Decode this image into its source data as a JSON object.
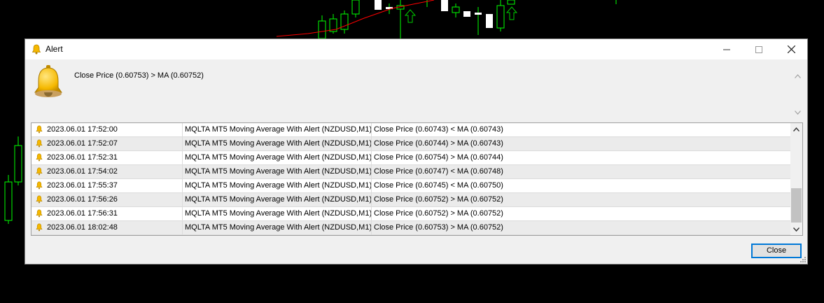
{
  "window": {
    "title": "Alert",
    "minimize_icon": "minimize-icon",
    "maximize_icon": "maximize-icon",
    "close_icon": "close-x-icon"
  },
  "icons": {
    "title": "bell-icon",
    "large": "bell-icon",
    "row": "bell-icon"
  },
  "message": "Close Price (0.60753) > MA (0.60752)",
  "alerts": [
    {
      "time": "2023.06.01 17:52:00",
      "source": "MQLTA MT5 Moving Average With Alert (NZDUSD,M1)",
      "text": "Close Price (0.60743) < MA (0.60743)"
    },
    {
      "time": "2023.06.01 17:52:07",
      "source": "MQLTA MT5 Moving Average With Alert (NZDUSD,M1)",
      "text": "Close Price (0.60744) > MA (0.60743)"
    },
    {
      "time": "2023.06.01 17:52:31",
      "source": "MQLTA MT5 Moving Average With Alert (NZDUSD,M1)",
      "text": "Close Price (0.60754) > MA (0.60744)"
    },
    {
      "time": "2023.06.01 17:54:02",
      "source": "MQLTA MT5 Moving Average With Alert (NZDUSD,M1)",
      "text": "Close Price (0.60747) < MA (0.60748)"
    },
    {
      "time": "2023.06.01 17:55:37",
      "source": "MQLTA MT5 Moving Average With Alert (NZDUSD,M1)",
      "text": "Close Price (0.60745) < MA (0.60750)"
    },
    {
      "time": "2023.06.01 17:56:26",
      "source": "MQLTA MT5 Moving Average With Alert (NZDUSD,M1)",
      "text": "Close Price (0.60752) > MA (0.60752)"
    },
    {
      "time": "2023.06.01 17:56:31",
      "source": "MQLTA MT5 Moving Average With Alert (NZDUSD,M1)",
      "text": "Close Price (0.60752) > MA (0.60752)"
    },
    {
      "time": "2023.06.01 18:02:48",
      "source": "MQLTA MT5 Moving Average With Alert (NZDUSD,M1)",
      "text": "Close Price (0.60753) > MA (0.60752)"
    }
  ],
  "buttons": {
    "close": "Close"
  },
  "colors": {
    "chart_bg": "#000000",
    "bull_candle": "#00ff00",
    "bear_candle": "#ffffff",
    "ma_line": "#ff0000",
    "bell": "#f5b800",
    "focus": "#0078d7"
  }
}
